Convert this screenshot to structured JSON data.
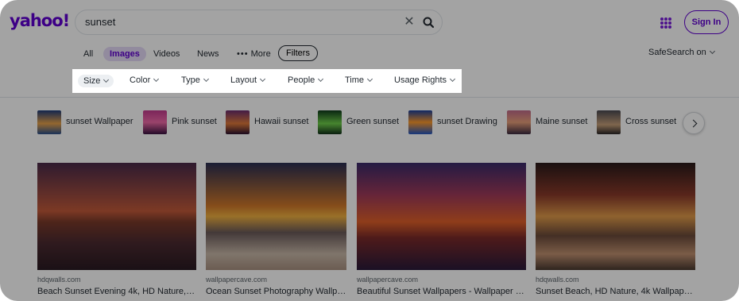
{
  "header": {
    "logo": "yahoo!",
    "search_value": "sunset",
    "signin_label": "Sign In"
  },
  "tabs": [
    {
      "label": "All"
    },
    {
      "label": "Images"
    },
    {
      "label": "Videos"
    },
    {
      "label": "News"
    },
    {
      "label": "More"
    }
  ],
  "filters_label": "Filters",
  "safesearch_label": "SafeSearch on",
  "filter_bar": [
    {
      "label": "Size"
    },
    {
      "label": "Color"
    },
    {
      "label": "Type"
    },
    {
      "label": "Layout"
    },
    {
      "label": "People"
    },
    {
      "label": "Time"
    },
    {
      "label": "Usage Rights"
    }
  ],
  "related": [
    {
      "label": "sunset Wallpaper"
    },
    {
      "label": "Pink sunset"
    },
    {
      "label": "Hawaii sunset"
    },
    {
      "label": "Green sunset"
    },
    {
      "label": "sunset Drawing"
    },
    {
      "label": "Maine sunset"
    },
    {
      "label": "Cross sunset"
    }
  ],
  "results": [
    {
      "source": "hdqwalls.com",
      "title": "Beach Sunset Evening 4k, HD Nature, 4k…"
    },
    {
      "source": "wallpapercave.com",
      "title": "Ocean Sunset Photography Wallpa…"
    },
    {
      "source": "wallpapercave.com",
      "title": "Beautiful Sunset Wallpapers - Wallpaper C…"
    },
    {
      "source": "hdqwalls.com",
      "title": "Sunset Beach, HD Nature, 4k Wallpaper…"
    }
  ],
  "colors": {
    "brand": "#6001d2",
    "overlay": "rgba(0,0,0,0.36)"
  }
}
